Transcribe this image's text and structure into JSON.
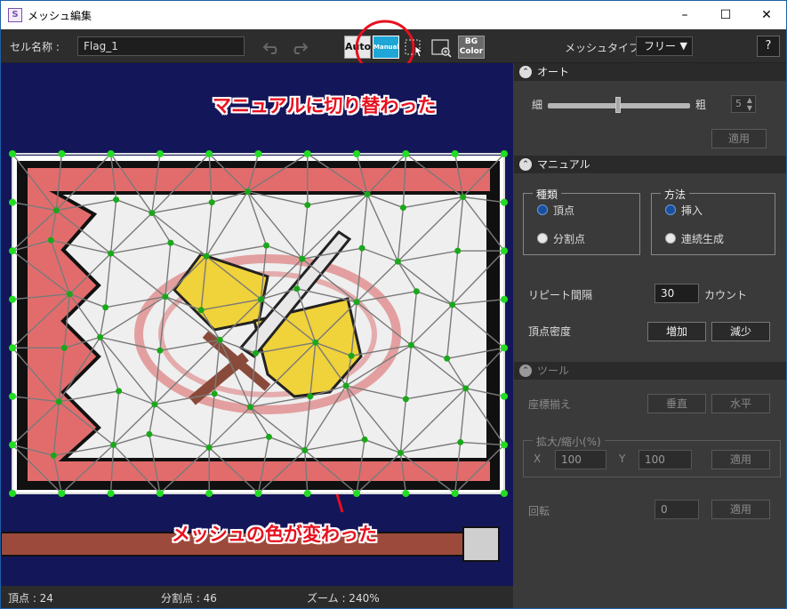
{
  "window": {
    "title": "メッシュ編集",
    "minimize": "–",
    "maximize": "☐",
    "close": "✕",
    "app_icon": "S"
  },
  "toolbar": {
    "cell_name_label": "セル名称 :",
    "cell_name_value": "Flag_1",
    "auto_label": "Auto",
    "manual_label": "Manual",
    "bg_color_label_1": "BG",
    "bg_color_label_2": "Color",
    "mesh_type_label": "メッシュタイプ :",
    "mesh_type_value": "フリー",
    "help_label": "?"
  },
  "annotations": {
    "top": "マニュアルに切り替わった",
    "bottom": "メッシュの色が変わった"
  },
  "status": {
    "vertices": "頂点 : 24",
    "divisions": "分割点 : 46",
    "zoom": "ズーム : 240%"
  },
  "auto_section": {
    "header": "オート",
    "fine_label": "細",
    "coarse_label": "粗",
    "density_value": "5",
    "density_slider_fraction": 0.5,
    "apply_label": "適用"
  },
  "manual_section": {
    "header": "マニュアル",
    "type_group": "種類",
    "type_vertex": "頂点",
    "type_division": "分割点",
    "method_group": "方法",
    "method_insert": "挿入",
    "method_continuous": "連続生成",
    "repeat_label": "リピート間隔",
    "repeat_value": "30",
    "count_label": "カウント",
    "density_label": "頂点密度",
    "increase_label": "増加",
    "decrease_label": "減少"
  },
  "tool_section": {
    "header": "ツール",
    "align_label": "座標揃え",
    "vertical_label": "垂直",
    "horizontal_label": "水平",
    "scale_group": "拡大/縮小(%)",
    "x_label": "X",
    "x_value": "100",
    "y_label": "Y",
    "y_value": "100",
    "scale_apply_label": "適用",
    "rotate_label": "回転",
    "rotate_value": "0",
    "rotate_apply_label": "適用"
  },
  "colors": {
    "mesh_vertex": "#1aa81a",
    "mesh_edge": "#7a7a7a",
    "selection": "#e8101f",
    "canvas_bg": "#14165a"
  }
}
